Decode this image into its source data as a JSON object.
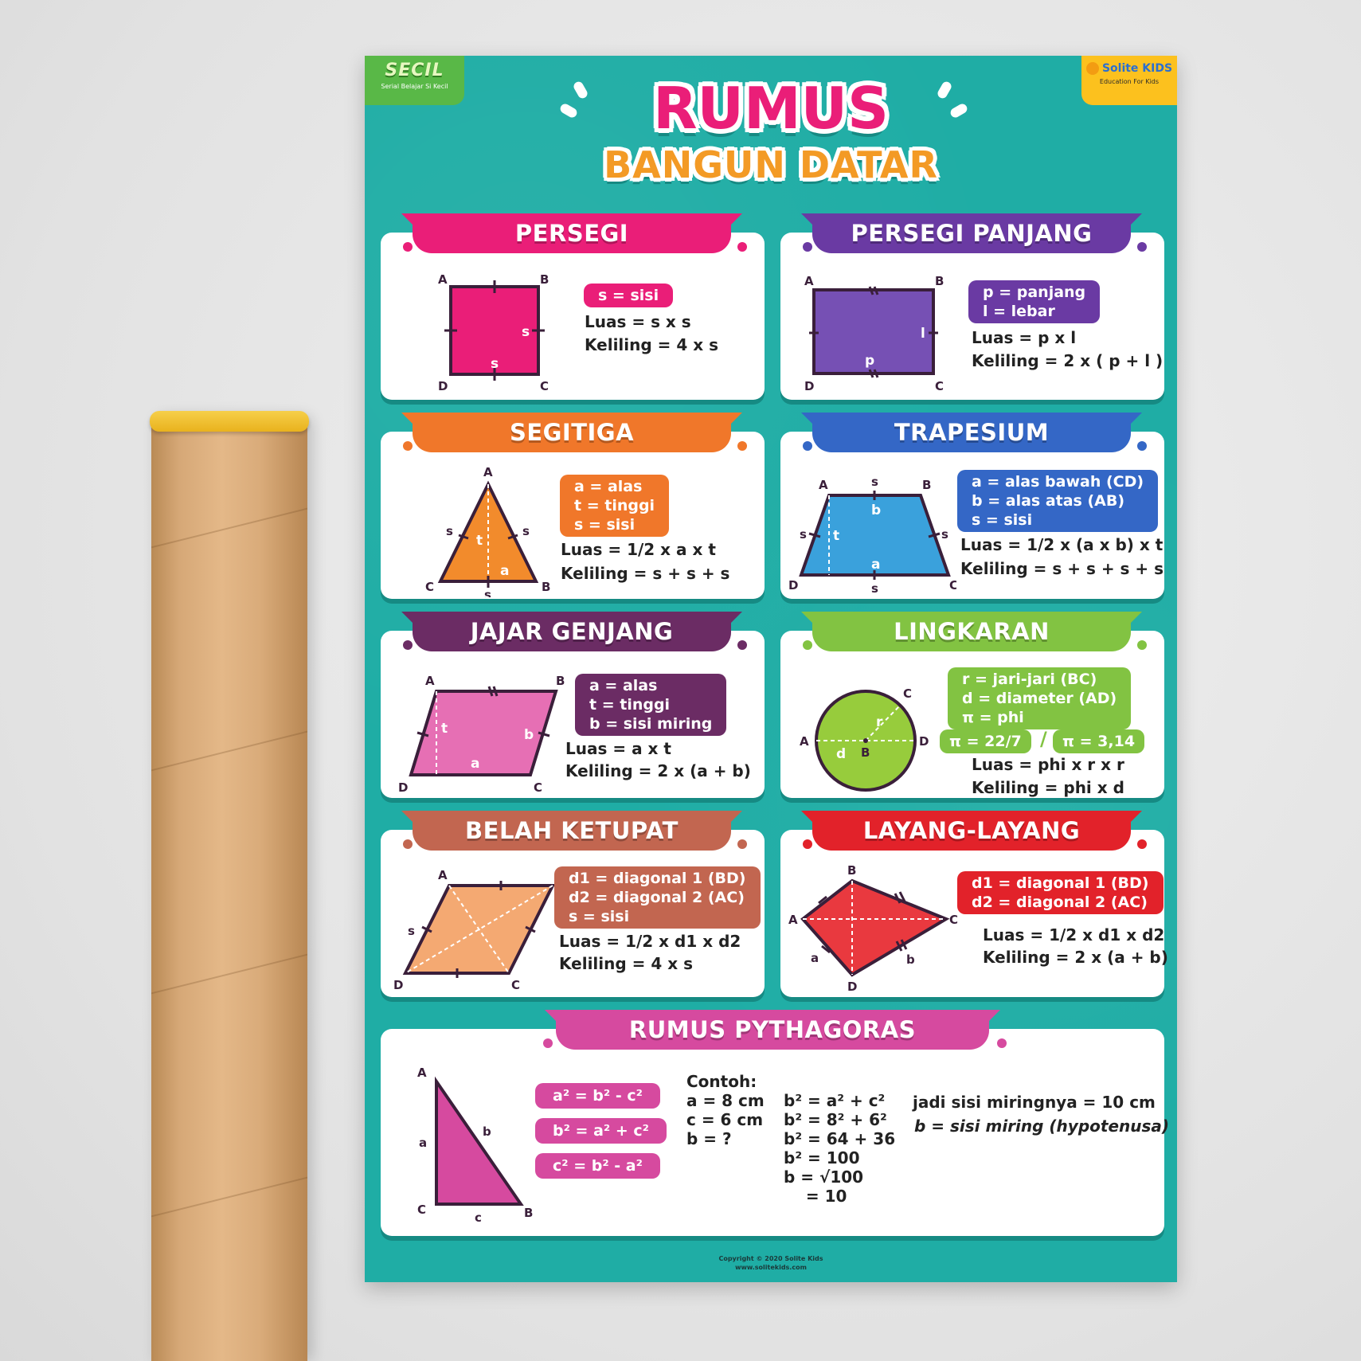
{
  "poster": {
    "badge_left": {
      "title": "SECIL",
      "subtitle": "Serial Belajar Si Kecil"
    },
    "badge_right": {
      "title": "Solite KIDS",
      "subtitle": "Education For Kids"
    },
    "title_line1": "RUMUS",
    "title_line2": "BANGUN DATAR",
    "copyright": "Copyright © 2020 Solite Kids",
    "website": "www.solitekids.com"
  },
  "colors": {
    "poster_bg": "#1fada5",
    "pink": "#ea1e78",
    "purple": "#6a3aa3",
    "orange": "#f0772a",
    "blue": "#3467c6",
    "plum": "#6b2c64",
    "green": "#82c342",
    "brown": "#c26650",
    "red": "#e2222a",
    "magenta": "#d64a9f"
  },
  "persegi": {
    "title": "PERSEGI",
    "vars": [
      "s = sisi"
    ],
    "formulas": [
      "Luas = s x s",
      "Keliling = 4 x s"
    ],
    "labels": {
      "A": "A",
      "B": "B",
      "C": "C",
      "D": "D",
      "s1": "s",
      "s2": "s"
    }
  },
  "persegi_panjang": {
    "title": "PERSEGI PANJANG",
    "vars": [
      "p = panjang",
      "l  = lebar"
    ],
    "formulas": [
      "Luas = p x l",
      "Keliling = 2 x ( p + l )"
    ],
    "labels": {
      "A": "A",
      "B": "B",
      "C": "C",
      "D": "D",
      "l": "l",
      "p": "p"
    }
  },
  "segitiga": {
    "title": "SEGITIGA",
    "vars": [
      "a = alas",
      "t = tinggi",
      "s = sisi"
    ],
    "formulas": [
      "Luas = 1/2 x a x t",
      "Keliling = s + s + s"
    ],
    "labels": {
      "A": "A",
      "B": "B",
      "C": "C",
      "s1": "s",
      "s2": "s",
      "s3": "s",
      "t": "t",
      "a": "a"
    }
  },
  "trapesium": {
    "title": "TRAPESIUM",
    "vars": [
      "a = alas bawah (CD)",
      "b = alas atas (AB)",
      "s = sisi"
    ],
    "formulas": [
      "Luas = 1/2 x (a x b) x t",
      "Keliling = s + s + s + s"
    ],
    "labels": {
      "A": "A",
      "B": "B",
      "C": "C",
      "D": "D",
      "s1": "s",
      "s2": "s",
      "s3": "s",
      "s4": "s",
      "t": "t",
      "a": "a",
      "b": "b"
    }
  },
  "jajar_genjang": {
    "title": "JAJAR GENJANG",
    "vars": [
      "a = alas",
      "t = tinggi",
      "b = sisi miring"
    ],
    "formulas": [
      "Luas =  a x t",
      "Keliling =  2 x (a + b)"
    ],
    "labels": {
      "A": "A",
      "B": "B",
      "C": "C",
      "D": "D",
      "t": "t",
      "a": "a",
      "b": "b"
    }
  },
  "lingkaran": {
    "title": "LINGKARAN",
    "vars": [
      "r = jari-jari (BC)",
      "d = diameter (AD)",
      "π  = phi"
    ],
    "pi_values": [
      "π  = 22/7",
      "π  = 3,14"
    ],
    "separator": "/",
    "formulas": [
      "Luas =  phi x r x r",
      "Keliling =  phi x d"
    ],
    "labels": {
      "A": "A",
      "B": "B",
      "C": "C",
      "D": "D",
      "r": "r",
      "d": "d"
    }
  },
  "belah_ketupat": {
    "title": "BELAH KETUPAT",
    "vars": [
      "d1  = diagonal 1 (BD)",
      "d2  = diagonal 2 (AC)",
      "s = sisi"
    ],
    "formulas": [
      "Luas =  1/2 x d1 x d2",
      "Keliling =  4 x s"
    ],
    "labels": {
      "A": "A",
      "B": "B",
      "C": "C",
      "D": "D",
      "s": "s"
    }
  },
  "layang_layang": {
    "title": "LAYANG-LAYANG",
    "vars": [
      "d1  = diagonal 1 (BD)",
      "d2  = diagonal 2 (AC)"
    ],
    "formulas": [
      "Luas =  1/2 x d1 x d2",
      "Keliling =  2 x (a + b)"
    ],
    "labels": {
      "A": "A",
      "B": "B",
      "C": "C",
      "D": "D",
      "a": "a",
      "b": "b"
    }
  },
  "pythagoras": {
    "title": "RUMUS PYTHAGORAS",
    "formulas": [
      "a² = b² - c²",
      "b² = a² + c²",
      "c² = b² - a²"
    ],
    "example_title": "Contoh:",
    "given": [
      "a = 8 cm",
      "c = 6 cm",
      "b =  ?"
    ],
    "steps": [
      "b² = a²  +  c²",
      "b² = 8²  +  6²",
      "b² = 64 + 36",
      "b² = 100",
      "b  = √100",
      "    = 10"
    ],
    "conclusion": "jadi sisi miringnya = 10 cm",
    "note": "b = sisi miring (hypotenusa)",
    "labels": {
      "A": "A",
      "B": "B",
      "C": "C",
      "a": "a",
      "b": "b",
      "c": "c"
    }
  }
}
